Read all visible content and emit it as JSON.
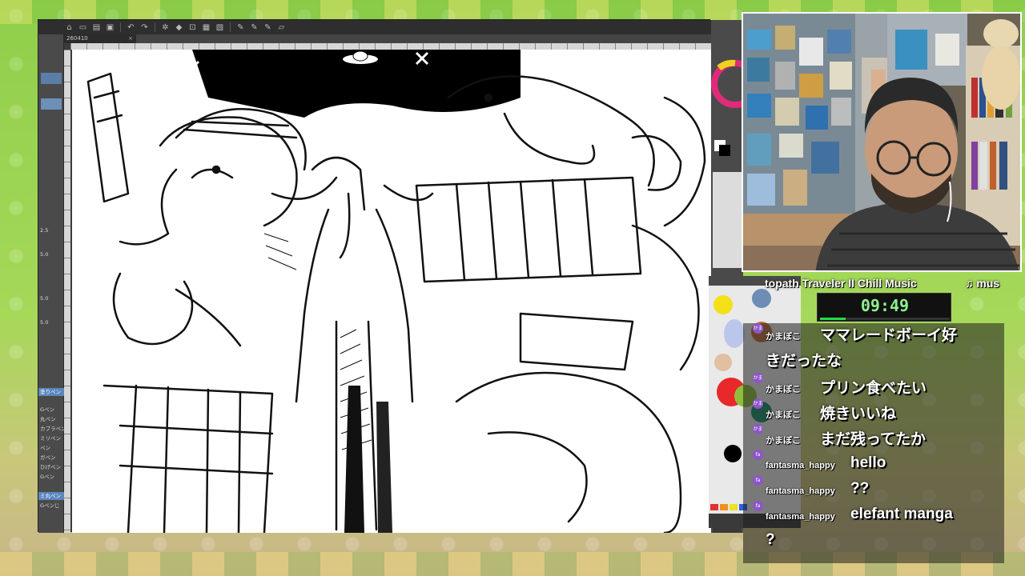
{
  "app": {
    "document_tab": "260410",
    "toolbar_icons": [
      "home-icon",
      "new-file-icon",
      "open-icon",
      "save-icon",
      "undo-icon",
      "redo-icon",
      "settings-icon",
      "fill-icon",
      "transform-icon"
    ],
    "left_panel_items": [
      "塗りペン",
      "Gペン",
      "丸ペン",
      "カブラペン",
      "ミリペン",
      "ペン",
      "ガペン",
      "ひげペン",
      "Gペン",
      "ミ丸ペン",
      "Gペンじ"
    ],
    "left_panel_numbers": [
      "2.5",
      "5.0",
      "5.0",
      "5.0"
    ]
  },
  "stream": {
    "music_title": "topath Traveler II Chill Music",
    "music_note": "♫ mus",
    "timer": "09:49",
    "timer_progress": 0.2,
    "chat": [
      {
        "user": "かまぼこ",
        "badge": "かま",
        "message": "ママレードボーイ好",
        "message_cont": "きだったな"
      },
      {
        "user": "かまぼこ",
        "badge": "かま",
        "message": "プリン食べたい"
      },
      {
        "user": "かまぼこ",
        "badge": "かま",
        "message": "焼きいいね"
      },
      {
        "user": "かまぼこ",
        "badge": "かま",
        "message": "まだ残ってたか"
      },
      {
        "user": "fantasma_happy",
        "badge": "fa",
        "message": "hello"
      },
      {
        "user": "fantasma_happy",
        "badge": "fa",
        "message": "??"
      },
      {
        "user": "fantasma_happy",
        "badge": "fa",
        "message": "elefant manga",
        "message_cont": "?"
      }
    ]
  },
  "colors": {
    "timer_text": "#8ef08e",
    "timer_fill": "#22dd44",
    "badge": "#8e55c9",
    "selected_tool": "#5b86bd"
  }
}
